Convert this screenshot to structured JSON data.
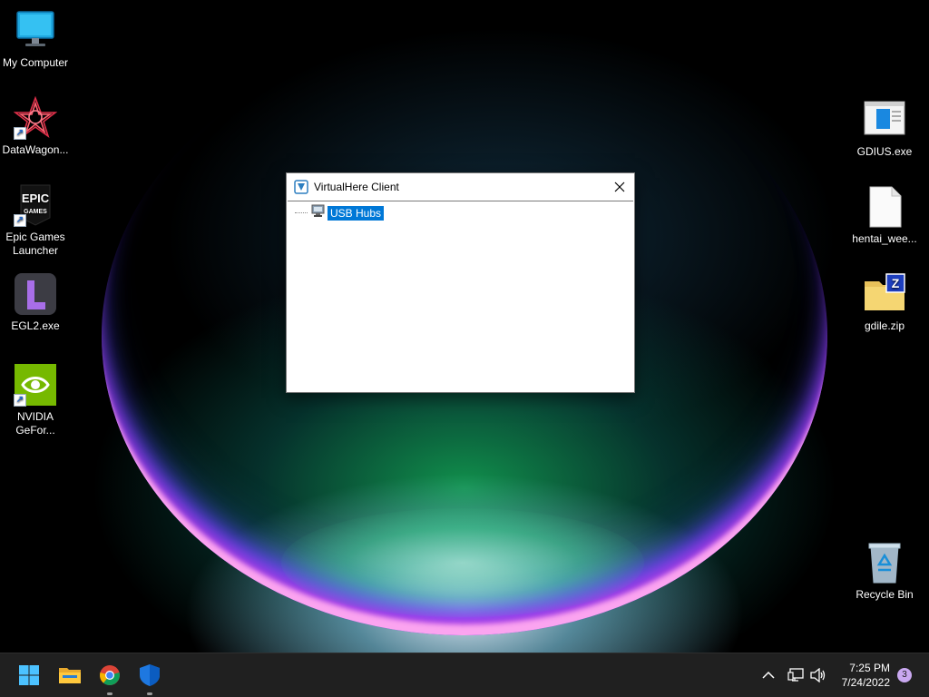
{
  "desktop": {
    "left_icons": [
      {
        "label": "My Computer",
        "icon": "monitor-icon"
      },
      {
        "label": "DataWagon...",
        "icon": "datawagon-logo-icon"
      },
      {
        "label": "Epic Games Launcher",
        "icon": "epic-games-icon"
      },
      {
        "label": "EGL2.exe",
        "icon": "egl2-icon"
      },
      {
        "label": "NVIDIA GeFor...",
        "icon": "nvidia-icon"
      }
    ],
    "right_icons": [
      {
        "label": "GDIUS.exe",
        "icon": "gdius-app-icon"
      },
      {
        "label": "hentai_wee...",
        "icon": "blank-file-icon"
      },
      {
        "label": "gdile.zip",
        "icon": "zip-folder-icon"
      },
      {
        "label": "Recycle Bin",
        "icon": "recycle-bin-icon"
      }
    ]
  },
  "window": {
    "title": "VirtualHere Client",
    "tree": [
      {
        "label": "USB Hubs",
        "selected": true,
        "icon": "usb-hub-icon"
      }
    ]
  },
  "taskbar": {
    "pinned": [
      {
        "name": "start",
        "icon": "windows-logo-icon"
      },
      {
        "name": "file-explorer",
        "icon": "folder-icon"
      },
      {
        "name": "chrome",
        "icon": "chrome-icon"
      },
      {
        "name": "defender",
        "icon": "shield-icon"
      }
    ],
    "tray_icons": [
      "chevron-up-icon",
      "network-icon",
      "volume-icon"
    ],
    "clock": {
      "time": "7:25 PM",
      "date": "7/24/2022"
    },
    "notification_count": "3"
  },
  "colors": {
    "selection": "#0078d7",
    "taskbar": "#202020",
    "badge": "#c9a8f0"
  }
}
